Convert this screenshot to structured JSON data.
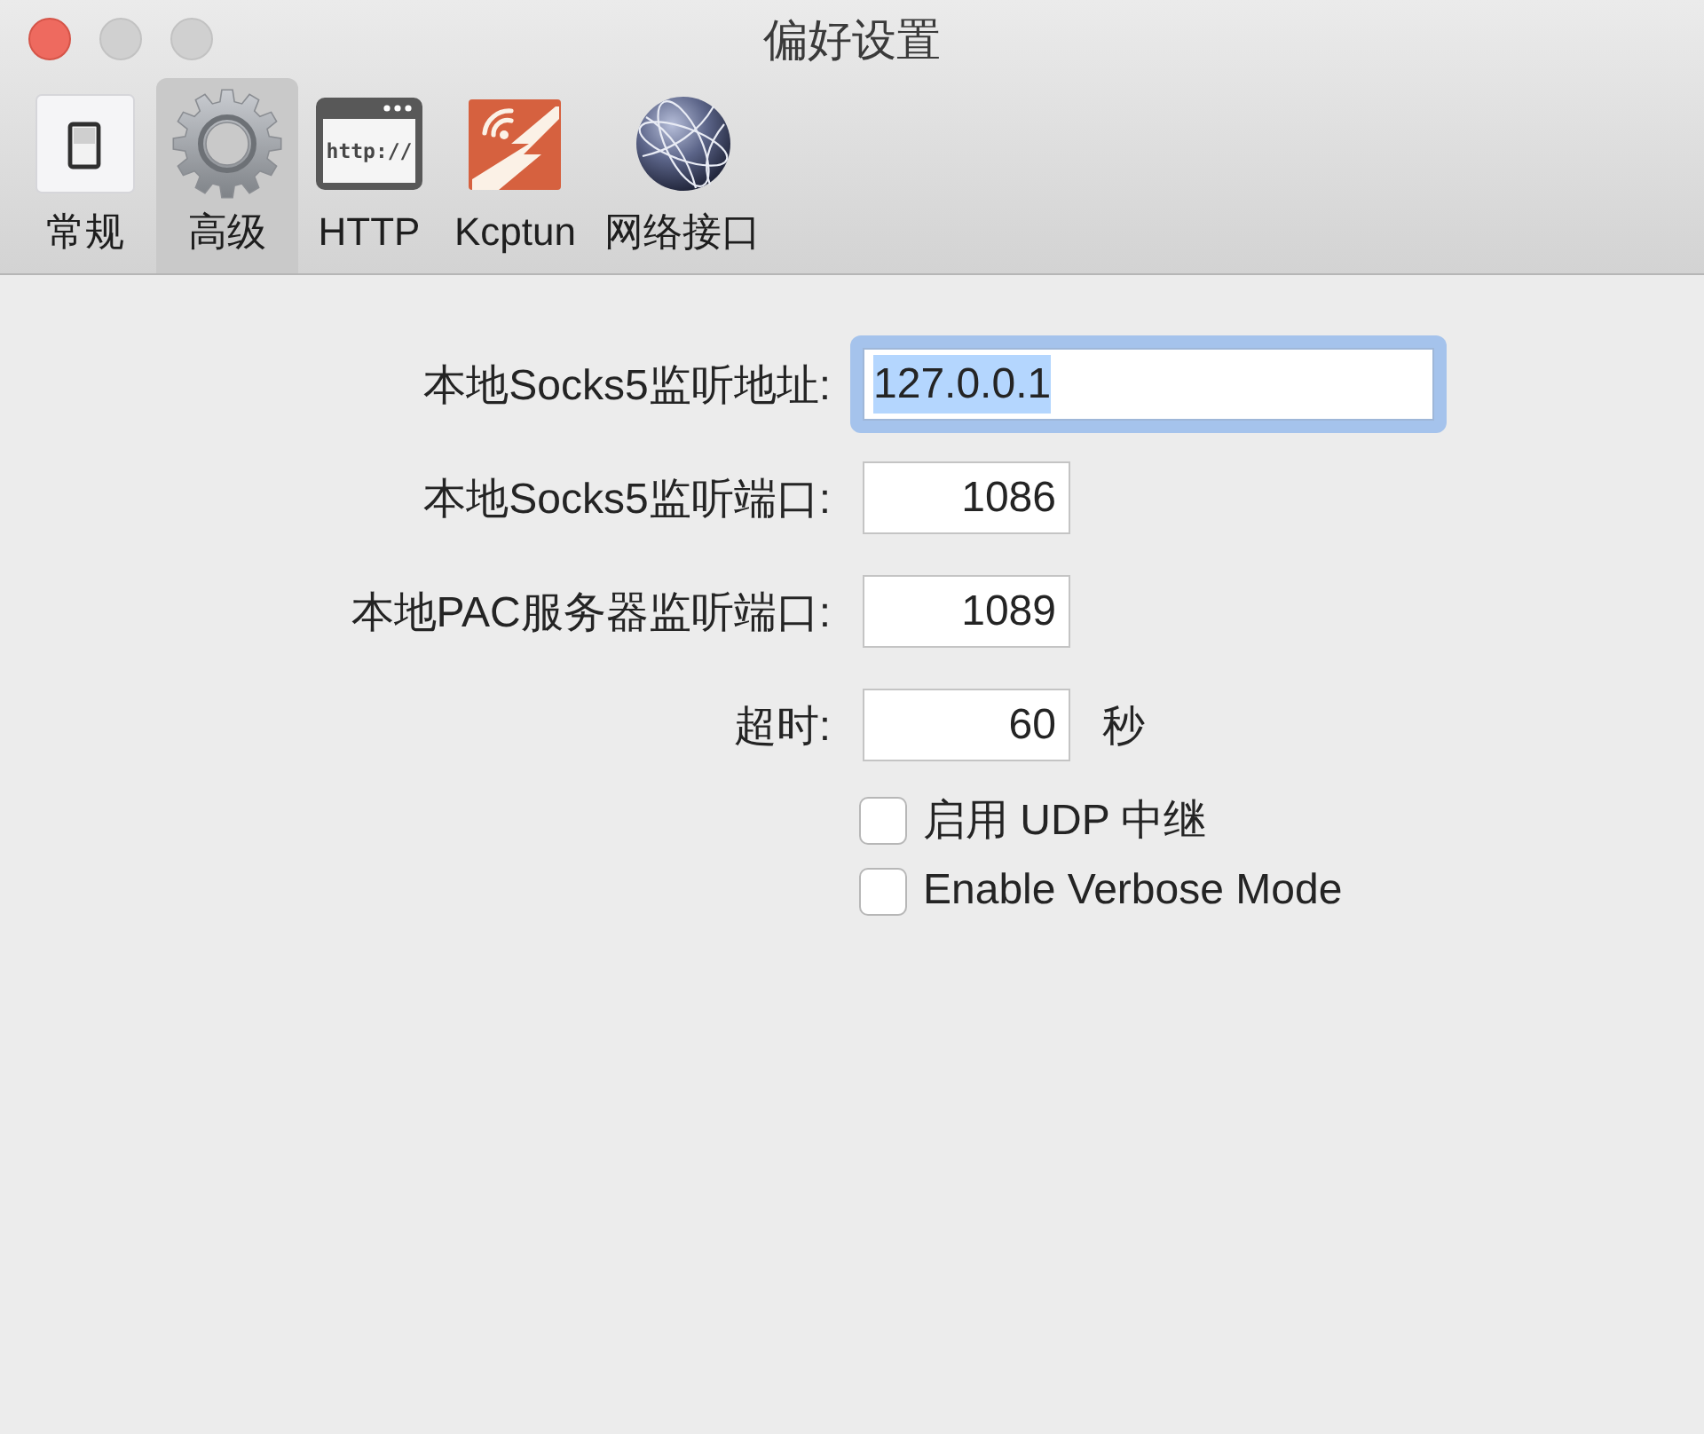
{
  "window": {
    "title": "偏好设置",
    "controls": [
      {
        "kind": "close",
        "disabled": false
      },
      {
        "kind": "minimize",
        "disabled": true
      },
      {
        "kind": "zoom",
        "disabled": true
      }
    ]
  },
  "toolbar": {
    "tabs": [
      {
        "label": "常规",
        "selected": false
      },
      {
        "label": "高级",
        "selected": true
      },
      {
        "label": "HTTP",
        "selected": false,
        "icon_text": "http://"
      },
      {
        "label": "Kcptun",
        "selected": false
      },
      {
        "label": "网络接口",
        "selected": false
      }
    ]
  },
  "form": {
    "fields": [
      {
        "label": "本地Socks5监听地址:",
        "kind": "text",
        "value": "127.0.0.1",
        "focused": true,
        "text_selected": true
      },
      {
        "label": "本地Socks5监听端口:",
        "kind": "number",
        "value": "1086",
        "focused": false,
        "text_selected": false
      },
      {
        "label": "本地PAC服务器监听端口:",
        "kind": "number",
        "value": "1089",
        "focused": false,
        "text_selected": false
      },
      {
        "label": "超时:",
        "kind": "number",
        "value": "60",
        "unit": "秒",
        "focused": false,
        "text_selected": false
      }
    ],
    "checkboxes": [
      {
        "label": "启用 UDP 中继",
        "checked": false
      },
      {
        "label": "Enable Verbose Mode",
        "checked": false
      }
    ]
  }
}
